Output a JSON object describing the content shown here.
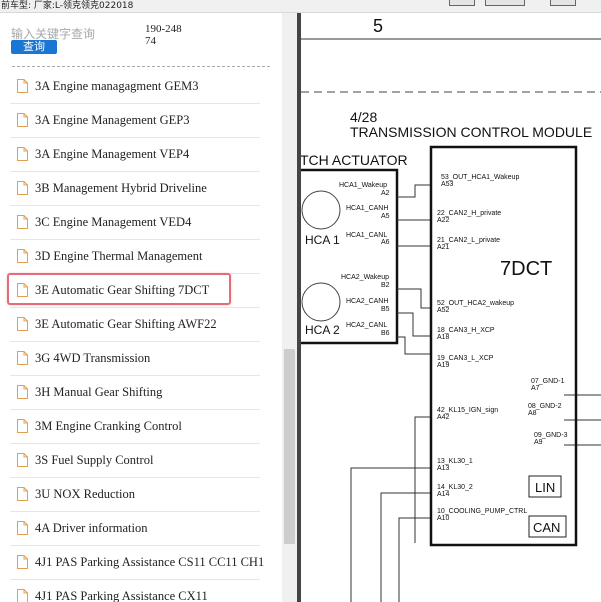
{
  "topbar": {
    "text": "前车型:  厂家:L-领克领克022018"
  },
  "sidebar": {
    "search_placeholder": "输入关键字查询",
    "search_button": "查询",
    "doc_code": "190-24874",
    "items": [
      {
        "label": "3A Engine managagment GEM3"
      },
      {
        "label": "3A Engine Management GEP3"
      },
      {
        "label": "3A Engine Management VEP4"
      },
      {
        "label": "3B Management Hybrid Driveline"
      },
      {
        "label": "3C Engine Management VED4"
      },
      {
        "label": "3D Engine Thermal Management"
      },
      {
        "label": "3E Automatic Gear Shifting 7DCT",
        "selected": true
      },
      {
        "label": "3E Automatic Gear Shifting AWF22"
      },
      {
        "label": "3G 4WD Transmission"
      },
      {
        "label": "3H Manual Gear Shifting"
      },
      {
        "label": "3M Engine Cranking Control"
      },
      {
        "label": "3S Fuel Supply Control"
      },
      {
        "label": "3U NOX Reduction"
      },
      {
        "label": "4A Driver information"
      },
      {
        "label": "4J1 PAS Parking Assistance CS11 CC11 CH1"
      },
      {
        "label": "4J1 PAS Parking Assistance CX11"
      }
    ]
  },
  "diagram": {
    "sheet_number": "5",
    "page_ref": "4/28",
    "module_title": "TRANSMISSION CONTROL MODULE",
    "actuator_title": "TCH ACTUATOR",
    "module_name": "7DCT",
    "hca1": {
      "label": "HCA 1",
      "pins": [
        "HCA1_Wakeup",
        "A2",
        "HCA1_CANH",
        "A5",
        "HCA1_CANL",
        "A6"
      ]
    },
    "hca2": {
      "label": "HCA 2",
      "pins": [
        "HCA2_Wakeup",
        "B2",
        "HCA2_CANH",
        "B5",
        "HCA2_CANL",
        "B6"
      ]
    },
    "module_pins": [
      {
        "name": "53_OUT_HCA1_Wakeup",
        "pin": "A53"
      },
      {
        "name": "22_CAN2_H_private",
        "pin": "A22"
      },
      {
        "name": "21_CAN2_L_private",
        "pin": "A21"
      },
      {
        "name": "52_OUT_HCA2_wakeup",
        "pin": "A52"
      },
      {
        "name": "18_CAN3_H_XCP",
        "pin": "A18"
      },
      {
        "name": "19_CAN3_L_XCP",
        "pin": "A19"
      },
      {
        "name": "42_KL15_IGN_sign",
        "pin": "A42"
      },
      {
        "name": "13_KL30_1",
        "pin": "A13"
      },
      {
        "name": "14_KL30_2",
        "pin": "A14"
      },
      {
        "name": "10_COOLING_PUMP_CTRL",
        "pin": "A10"
      }
    ],
    "gnd_pins": [
      {
        "name": "07_GND-1",
        "pin": "A7"
      },
      {
        "name": "08_GND-2",
        "pin": "A8"
      },
      {
        "name": "09_GND-3",
        "pin": "A9"
      }
    ],
    "lin_label": "LIN",
    "can_label": "CAN"
  }
}
